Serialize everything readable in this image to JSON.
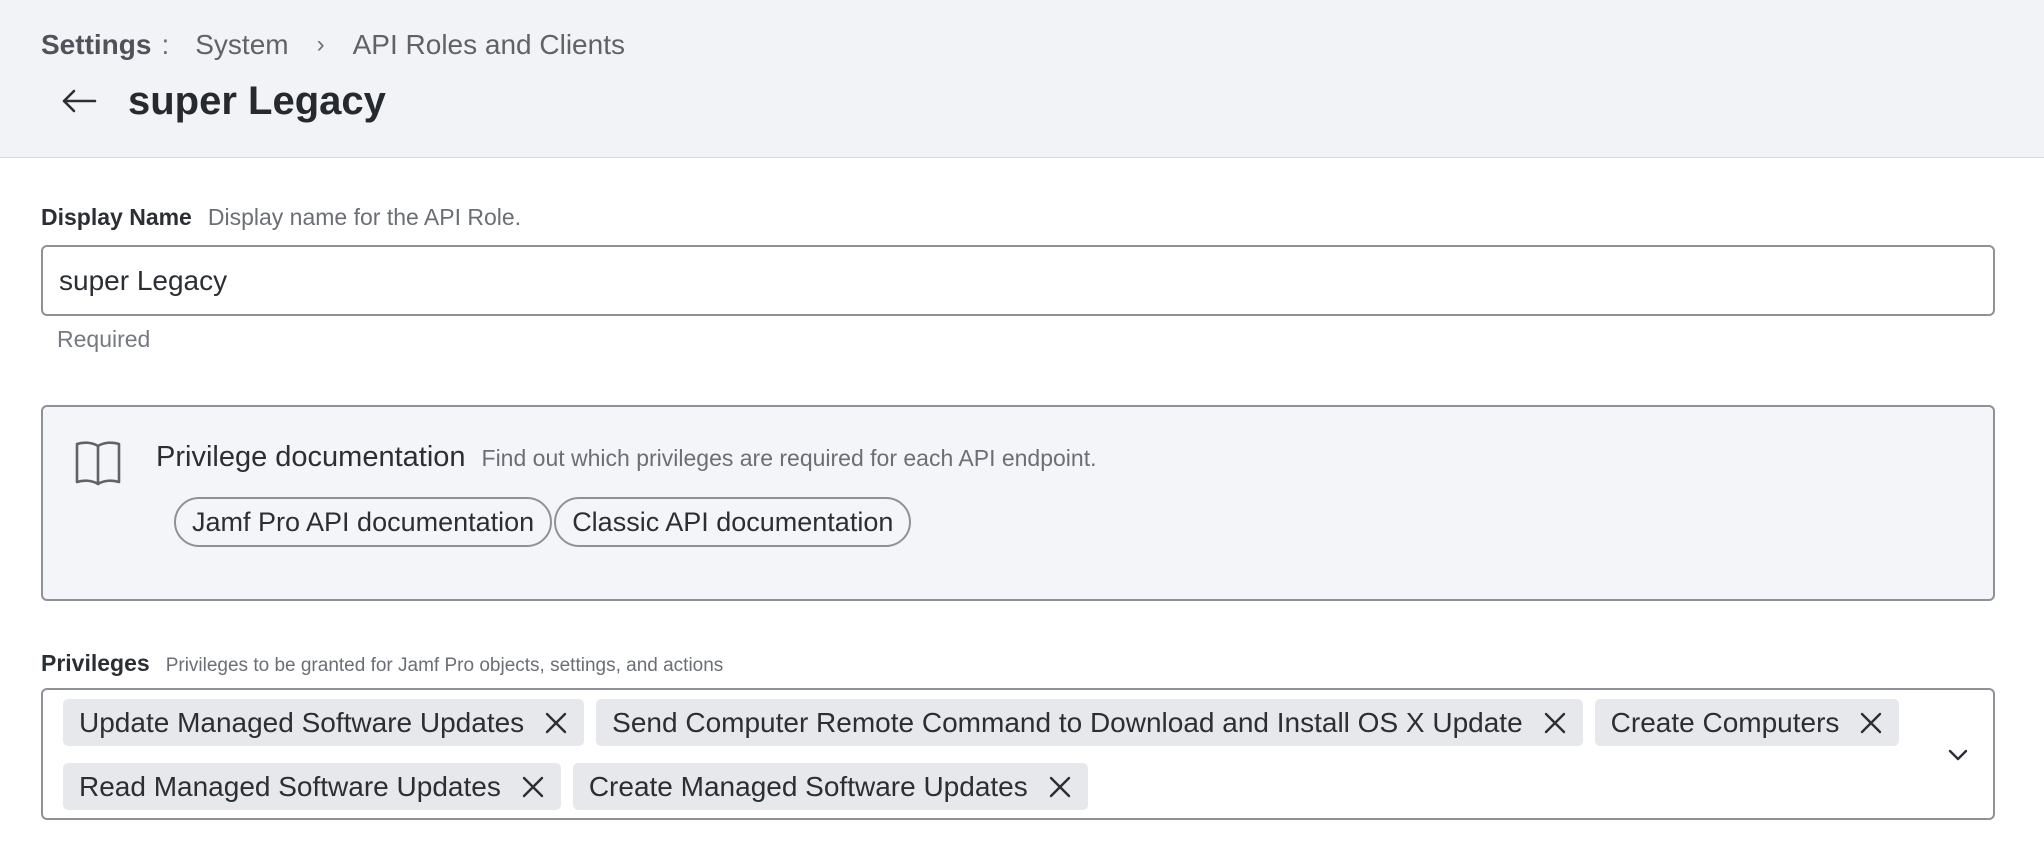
{
  "breadcrumb": {
    "root": "Settings",
    "separator_colon": ":",
    "items": [
      "System",
      "API Roles and Clients"
    ],
    "chevron": "›"
  },
  "page": {
    "title": "super Legacy",
    "back_icon": "arrow-left-icon"
  },
  "display_name": {
    "label": "Display Name",
    "description": "Display name for the API Role.",
    "value": "super Legacy",
    "helper": "Required"
  },
  "privilege_docs": {
    "icon": "book-icon",
    "title": "Privilege documentation",
    "description": "Find out which privileges are required for each API endpoint.",
    "links": [
      "Jamf Pro API documentation",
      "Classic API documentation"
    ]
  },
  "privileges": {
    "label": "Privileges",
    "description": "Privileges to be granted for Jamf Pro objects, settings, and actions",
    "selected": [
      "Update Managed Software Updates",
      "Send Computer Remote Command to Download and Install OS X Update",
      "Create Computers",
      "Read Managed Software Updates",
      "Create Managed Software Updates"
    ],
    "remove_icon": "close-icon",
    "toggle_icon": "chevron-down-icon"
  },
  "colors": {
    "header_bg": "#f2f3f6",
    "border": "#8e9298",
    "chip_bg": "#e6e8eb",
    "text_primary": "#2b2e33",
    "text_muted": "#6b6f75"
  }
}
